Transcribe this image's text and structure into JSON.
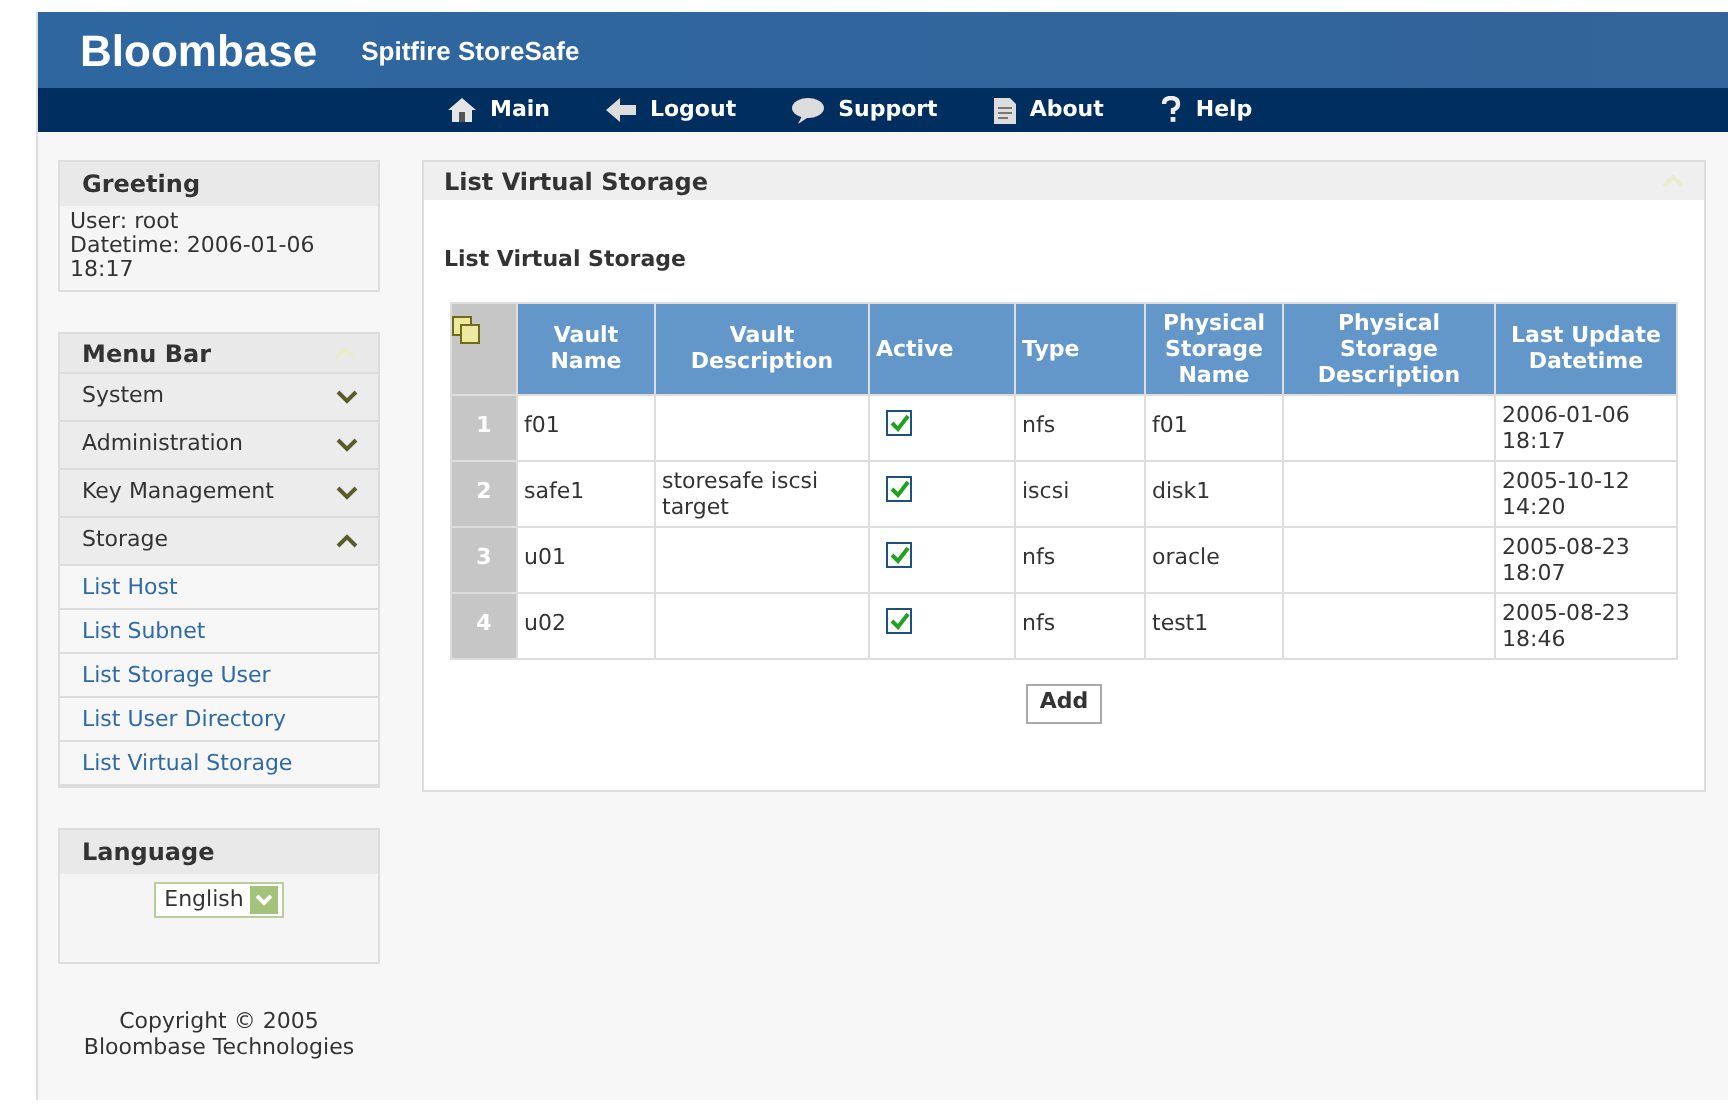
{
  "header": {
    "brand": "Bloombase",
    "product": "Spitfire StoreSafe"
  },
  "nav": [
    {
      "label": "Main",
      "kind": "home"
    },
    {
      "label": "Logout",
      "kind": "back"
    },
    {
      "label": "Support",
      "kind": "chat"
    },
    {
      "label": "About",
      "kind": "doc"
    },
    {
      "label": "Help",
      "kind": "help"
    }
  ],
  "greeting": {
    "title": "Greeting",
    "lines": [
      "User: root",
      "Datetime: 2006-01-06 18:17"
    ]
  },
  "menu": {
    "title": "Menu Bar",
    "groups": [
      {
        "label": "System",
        "expanded": false
      },
      {
        "label": "Administration",
        "expanded": false
      },
      {
        "label": "Key Management",
        "expanded": false
      },
      {
        "label": "Storage",
        "expanded": true,
        "children": [
          {
            "label": "List Host"
          },
          {
            "label": "List Subnet"
          },
          {
            "label": "List Storage User"
          },
          {
            "label": "List User Directory"
          },
          {
            "label": "List Virtual Storage"
          }
        ]
      }
    ]
  },
  "language": {
    "title": "Language",
    "value": "English"
  },
  "copyright": [
    "Copyright © 2005",
    "Bloombase Technologies"
  ],
  "panel": {
    "title": "List Virtual Storage",
    "subtitle": "List Virtual Storage",
    "table": {
      "columns": [
        "Vault Name",
        "Vault Description",
        "Active",
        "Type",
        "Physical Storage Name",
        "Physical Storage Description",
        "Last Update Datetime"
      ],
      "rows": [
        {
          "index": "1",
          "vault_name": "f01",
          "active": true,
          "type": "nfs",
          "physical_name": "f01",
          "updated": "2006-01-06 18:17"
        },
        {
          "index": "2",
          "vault_name": "safe1",
          "vault_description": "storesafe iscsi target",
          "active": true,
          "type": "iscsi",
          "physical_name": "disk1",
          "updated": "2005-10-12 14:20"
        },
        {
          "index": "3",
          "vault_name": "u01",
          "active": true,
          "type": "nfs",
          "physical_name": "oracle",
          "updated": "2005-08-23 18:07"
        },
        {
          "index": "4",
          "vault_name": "u02",
          "active": true,
          "type": "nfs",
          "physical_name": "test1",
          "updated": "2005-08-23 18:46"
        }
      ]
    },
    "button": "Add"
  }
}
